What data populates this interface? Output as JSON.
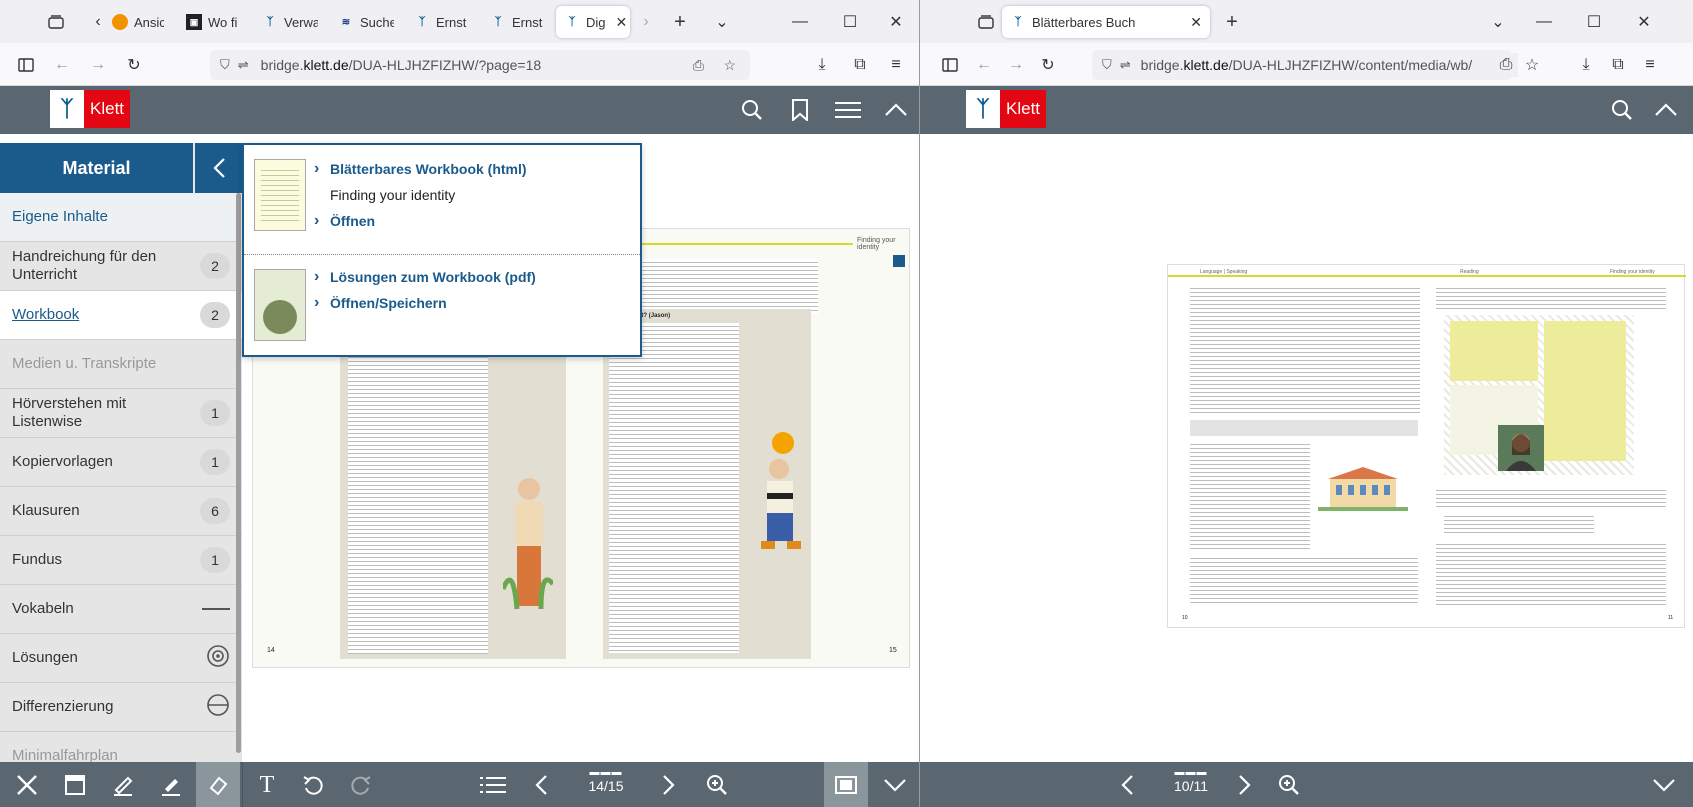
{
  "left_window": {
    "tabs": [
      {
        "label": "Ansich",
        "favicon": "orange-circle-icon"
      },
      {
        "label": "Wo fir",
        "favicon": "book-icon"
      },
      {
        "label": "Verwa",
        "favicon": "klett-icon"
      },
      {
        "label": "Suche",
        "favicon": "uni-icon"
      },
      {
        "label": "Ernst",
        "favicon": "klett-icon"
      },
      {
        "label": "Ernst",
        "favicon": "klett-icon"
      },
      {
        "label": "Dig",
        "favicon": "klett-icon"
      }
    ],
    "url_domain_pre": "bridge.",
    "url_domain": "klett.de",
    "url_path": "/DUA-HLJHZFIZHW/?page=18",
    "logo_text": "Klett",
    "sidebar": {
      "title": "Material",
      "items": [
        {
          "label": "Eigene Inhalte",
          "count": ""
        },
        {
          "label": "Handreichung für den Unterricht",
          "count": "2"
        },
        {
          "label": "Workbook",
          "count": "2"
        },
        {
          "label": "Medien u. Transkripte",
          "count": ""
        },
        {
          "label": "Hörverstehen mit Listenwise",
          "count": "1"
        },
        {
          "label": "Kopiervorlagen",
          "count": "1"
        },
        {
          "label": "Klausuren",
          "count": "6"
        },
        {
          "label": "Fundus",
          "count": "1"
        },
        {
          "label": "Vokabeln",
          "count": ""
        },
        {
          "label": "Lösungen",
          "count": ""
        },
        {
          "label": "Differenzierung",
          "count": ""
        },
        {
          "label": "Minimalfahrplan",
          "count": ""
        }
      ]
    },
    "popup": {
      "item1_link": "Blätterbares Workbook (html)",
      "item1_subtitle": "Finding your identity",
      "item1_action": "Öffnen",
      "item2_link": "Lösungen zum Workbook (pdf)",
      "item2_action": "Öffnen/Speichern"
    },
    "page": {
      "header": "Finding your identity",
      "left_no": "14",
      "right_no": "15",
      "box_title": "What's right? (Jason)"
    },
    "page_indicator": "14/15"
  },
  "right_window": {
    "tab_label": "Blätterbares Buch",
    "url_domain_pre": "bridge.",
    "url_domain": "klett.de",
    "url_path": "/DUA-HLJHZFIZHW/content/media/wb/",
    "logo_text": "Klett",
    "page": {
      "header_left": "Language | Speaking",
      "header_mid": "Reading",
      "header_right": "Finding your identity",
      "left_no": "10",
      "right_no": "11"
    },
    "page_indicator": "10/11"
  },
  "colors": {
    "brand_blue": "#1a5b8c",
    "klett_red": "#e30613",
    "toolbar_gray": "#5b6770",
    "accent_lime": "#d4dc2a"
  }
}
